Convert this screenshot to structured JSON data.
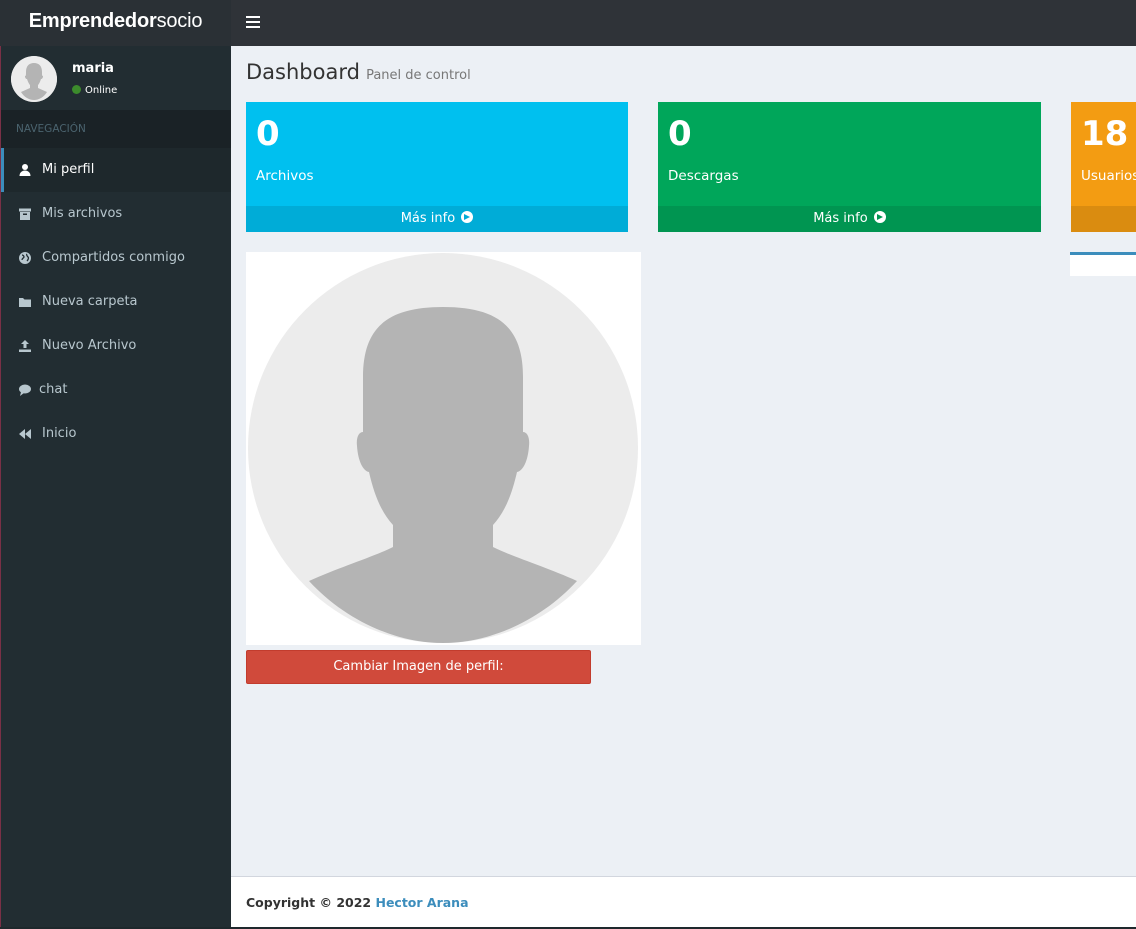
{
  "brand": {
    "bold": "Emprendedor",
    "light": "socio"
  },
  "user": {
    "name": "maria",
    "status": "Online"
  },
  "nav": {
    "header": "NAVEGACIÓN",
    "items": [
      {
        "label": "Mi perfil",
        "icon": "user-icon"
      },
      {
        "label": "Mis archivos",
        "icon": "archive-icon"
      },
      {
        "label": "Compartidos conmigo",
        "icon": "globe-icon"
      },
      {
        "label": "Nueva carpeta",
        "icon": "folder-icon"
      },
      {
        "label": "Nuevo Archivo",
        "icon": "upload-icon"
      },
      {
        "label": "chat",
        "icon": "comment-icon"
      },
      {
        "label": "Inicio",
        "icon": "backward-icon"
      }
    ]
  },
  "page": {
    "title": "Dashboard",
    "subtitle": "Panel de control"
  },
  "stats": [
    {
      "value": "0",
      "label": "Archivos",
      "more": "Más info",
      "color": "#00c0ef"
    },
    {
      "value": "0",
      "label": "Descargas",
      "more": "Más info",
      "color": "#00a65a"
    },
    {
      "value": "18",
      "label": "Usuarios",
      "color": "#f39c12"
    }
  ],
  "profile": {
    "change_button": "Cambiar Imagen de perfil:"
  },
  "footer": {
    "copyright": "Copyright © 2022",
    "author": "Hector Arana"
  },
  "colors": {
    "sidebar": "#222d32",
    "topbar": "#2f3338",
    "accent": "#3c8dbc",
    "danger": "#d04a3b"
  }
}
